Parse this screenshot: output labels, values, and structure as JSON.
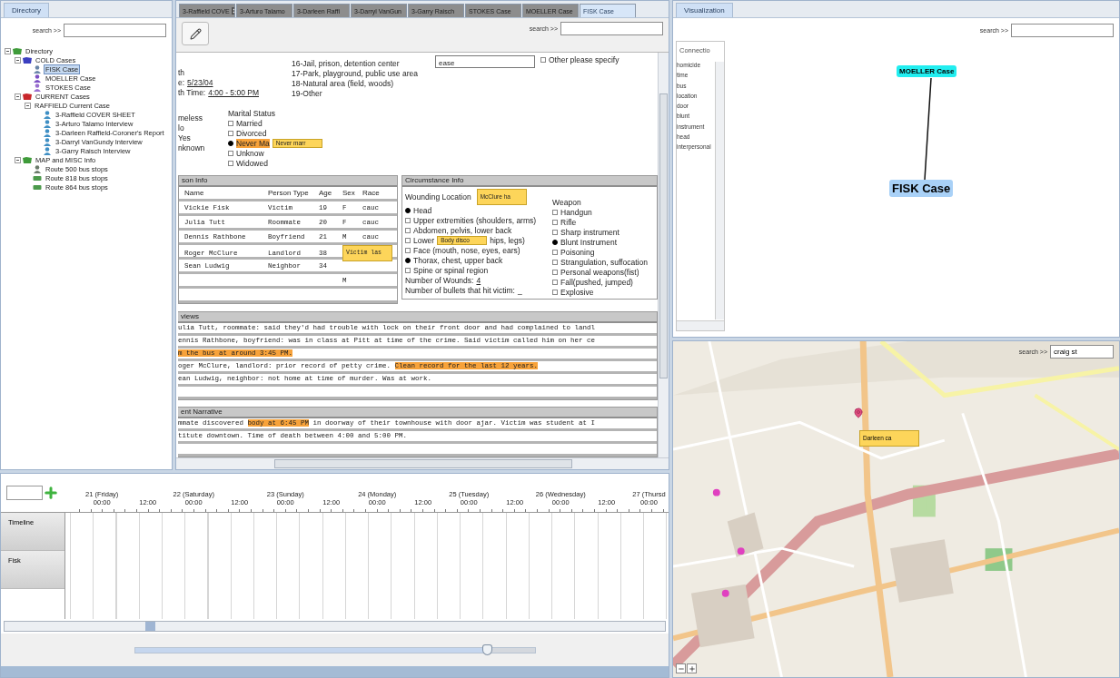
{
  "directory": {
    "tab": {
      "label": "Directory",
      "selected": true
    },
    "search_label": "search >>",
    "tree": [
      {
        "label": "Directory",
        "kind": "folder",
        "color": "#3f9b3a",
        "selected": false,
        "children": [
          {
            "label": "COLD Cases",
            "kind": "folder",
            "color": "#3b3fc0",
            "selected": false,
            "children": [
              {
                "label": "FISK Case",
                "kind": "person",
                "color": "#6a86a8",
                "selected": true
              },
              {
                "label": "MOELLER Case",
                "kind": "person",
                "color": "#7c4fc4",
                "selected": false
              },
              {
                "label": "STOKES Case",
                "kind": "person",
                "color": "#9a6fd0",
                "selected": false
              }
            ]
          },
          {
            "label": "CURRENT Cases",
            "kind": "folder",
            "color": "#c8262a",
            "selected": false,
            "children": [
              {
                "label": "RAFFIELD Current Case",
                "kind": "group",
                "selected": false,
                "children": [
                  {
                    "label": "3-Raffield COVER SHEET",
                    "kind": "person",
                    "color": "#3f8fc4",
                    "selected": false
                  },
                  {
                    "label": "3-Arturo Talamo Interview",
                    "kind": "person",
                    "color": "#3f8fc4",
                    "selected": false
                  },
                  {
                    "label": "3-Darleen Raffield-Coroner's Report",
                    "kind": "person",
                    "color": "#3f8fc4",
                    "selected": false
                  },
                  {
                    "label": "3-Darryl VanGundy Interview",
                    "kind": "person",
                    "color": "#3f8fc4",
                    "selected": false
                  },
                  {
                    "label": "3-Garry Raisch Interview",
                    "kind": "person",
                    "color": "#3f8fc4",
                    "selected": false
                  }
                ]
              }
            ]
          },
          {
            "label": "MAP and MISC Info",
            "kind": "folder",
            "color": "#3f9b3a",
            "selected": false,
            "children": [
              {
                "label": "Route 500 bus stops",
                "kind": "person",
                "color": "#6b7b6b",
                "selected": false
              },
              {
                "label": "Route 818 bus stops",
                "kind": "bus",
                "color": "#4c9a4c",
                "selected": false
              },
              {
                "label": "Route 864 bus stops",
                "kind": "bus",
                "color": "#4c9a4c",
                "selected": false
              }
            ]
          }
        ]
      }
    ]
  },
  "document": {
    "tabs": [
      {
        "label": "3-Raffield COVE",
        "selected": false,
        "closable": true
      },
      {
        "label": "3-Arturo Talamo",
        "selected": false
      },
      {
        "label": "3-Darleen Raffi",
        "selected": false
      },
      {
        "label": "3-Darryl VanGun",
        "selected": false
      },
      {
        "label": "3-Garry Raisch",
        "selected": false
      },
      {
        "label": "STOKES Case",
        "selected": false
      },
      {
        "label": "MOELLER Case",
        "selected": false
      },
      {
        "label": "FISK Case",
        "selected": true
      }
    ],
    "search_label": "search >>",
    "dates": [
      {
        "label": "th"
      },
      {
        "label": "e:",
        "value": "5/23/04"
      },
      {
        "label": "th Time:",
        "value": "4:00 - 5:00 PM"
      }
    ],
    "locations": [
      "16-Jail, prison, detention center",
      "17-Park, playground, public use area",
      "18-Natural area (field, woods)",
      "19-Other"
    ],
    "other_field": "ease",
    "other_option": {
      "label": "Other please specify",
      "selected": false
    },
    "homeless": [
      "meless",
      "lo",
      "Yes",
      "nknown"
    ],
    "marital": {
      "title": "Marital Status",
      "options": [
        {
          "label": "Married",
          "selected": false
        },
        {
          "label": "Divorced",
          "selected": false
        },
        {
          "label": "Never Ma",
          "selected": true,
          "note": "Never marr"
        },
        {
          "label": "Unknow",
          "selected": false
        },
        {
          "label": "Widowed",
          "selected": false
        }
      ]
    },
    "persons": {
      "title": "son Info",
      "columns": [
        "Name",
        "Person Type",
        "Age",
        "Sex",
        "Race"
      ],
      "rows": [
        {
          "kind": "entry",
          "cells": [
            "Vickie Fisk",
            "Victim",
            "19",
            "F",
            "cauc"
          ]
        },
        {
          "kind": "entry",
          "cells": [
            "Julia Tutt",
            "Roommate",
            "20",
            "F",
            "cauc"
          ]
        },
        {
          "kind": "entry",
          "cells": [
            "Dennis Rathbone",
            "Boyfriend",
            "21",
            "M",
            "cauc"
          ]
        },
        {
          "kind": "entry",
          "cells": [
            "Roger McClure",
            "Landlord",
            "38"
          ],
          "note": "Victim las"
        },
        {
          "kind": "entry",
          "cells": [
            "Sean Ludwig",
            "Neighbor",
            "34"
          ]
        },
        {
          "kind": "sex_only",
          "cells": [
            "M"
          ]
        },
        {
          "kind": "blank"
        }
      ]
    },
    "circumstance": {
      "title": "Circumstance Info",
      "wounding": {
        "title": "Wounding Location",
        "note": "McClure ha",
        "options": [
          {
            "label": "Head",
            "selected": true
          },
          {
            "label": "Upper extremities (shoulders, arms)",
            "selected": false
          },
          {
            "label": "Abdomen, pelvis, lower back",
            "selected": false
          },
          {
            "label": "Lower",
            "selected": false,
            "note": "Body disco",
            "after": "hips, legs)"
          },
          {
            "label": "Face (mouth, nose, eyes, ears)",
            "selected": false
          },
          {
            "label": "Thorax, chest, upper back",
            "selected": true
          },
          {
            "label": "Spine or spinal region",
            "selected": false
          }
        ]
      },
      "wounds_label": "Number of Wounds:",
      "wounds_value": "4",
      "bullets_label": "Number of bullets that hit victim:",
      "bullets_value": "_",
      "weapon": {
        "title": "Weapon",
        "options": [
          {
            "label": "Handgun",
            "selected": false
          },
          {
            "label": "Rifle",
            "selected": false
          },
          {
            "label": "Sharp instrument",
            "selected": false
          },
          {
            "label": "Blunt Instrument",
            "selected": true
          },
          {
            "label": "Poisoning",
            "selected": false
          },
          {
            "label": "Strangulation, suffocation",
            "selected": false
          },
          {
            "label": "Personal weapons(fist)",
            "selected": false
          },
          {
            "label": "Fall(pushed, jumped)",
            "selected": false
          },
          {
            "label": "Explosive",
            "selected": false
          }
        ]
      }
    },
    "interviews": {
      "title": "views",
      "rows": [
        {
          "kind": "text",
          "segments": [
            {
              "text": "ulia Tutt, roommate: said they'd had trouble with lock on their front door and had complained to landl",
              "highlighted": false
            }
          ]
        },
        {
          "kind": "text",
          "segments": [
            {
              "text": "ennis Rathbone, boyfriend: was in class at Pitt at time of the crime. Said victim called him on her ce",
              "highlighted": false
            }
          ]
        },
        {
          "kind": "text",
          "segments": [
            {
              "text": "m the bus at around 3:45 PM.",
              "highlighted": true
            }
          ]
        },
        {
          "kind": "text",
          "segments": [
            {
              "text": "oger McClure, landlord: prior record of petty crime. ",
              "highlighted": false
            },
            {
              "text": "Clean record for the last 12 years.",
              "highlighted": true
            }
          ]
        },
        {
          "kind": "text",
          "segments": [
            {
              "text": "ean Ludwig, neighbor: not home at time of murder. Was at work.",
              "highlighted": false
            }
          ]
        },
        {
          "kind": "blank"
        }
      ]
    },
    "narrative": {
      "title": "ent Narrative",
      "rows": [
        {
          "kind": "text",
          "segments": [
            {
              "text": "mmate discovered ",
              "highlighted": false
            },
            {
              "text": "body at 6:45 PM",
              "highlighted": true
            },
            {
              "text": " in doorway of their townhouse with door ajar. Victim was student at I",
              "highlighted": false
            }
          ]
        },
        {
          "kind": "text",
          "segments": [
            {
              "text": "titute downtown. Time of death between 4:00 and 5:00 PM.",
              "highlighted": false
            }
          ]
        },
        {
          "kind": "blank"
        }
      ]
    }
  },
  "timeline": {
    "days": [
      {
        "label": "21 (Friday)",
        "times": [
          "00:00",
          "12:00"
        ]
      },
      {
        "label": "22 (Saturday)",
        "times": [
          "00:00",
          "12:00"
        ]
      },
      {
        "label": "23 (Sunday)",
        "times": [
          "00:00",
          "12:00"
        ]
      },
      {
        "label": "24 (Monday)",
        "times": [
          "00:00",
          "12:00"
        ]
      },
      {
        "label": "25 (Tuesday)",
        "times": [
          "00:00",
          "12:00"
        ]
      },
      {
        "label": "26 (Wednesday)",
        "times": [
          "00:00",
          "12:00"
        ]
      },
      {
        "label": "27 (Thursd",
        "times": [
          "00:00"
        ]
      }
    ],
    "tracks": [
      "Timeline",
      "Fisk"
    ],
    "zoom": {
      "level": 0.88
    }
  },
  "visualization": {
    "tab": {
      "label": "Visualization",
      "selected": true
    },
    "search_label": "search >>",
    "connections": {
      "title": "Connectio",
      "items": [
        "homicide",
        "time",
        "bus",
        "location",
        "door",
        "blunt",
        "instrument",
        "head",
        "interpersonal"
      ]
    },
    "nodes": [
      {
        "label": "MOELLER Case",
        "kind": "related"
      },
      {
        "label": "FISK Case",
        "kind": "focus"
      }
    ]
  },
  "map": {
    "search_label": "search >>",
    "search_value": "craig st",
    "note": "Darleen ca"
  }
}
